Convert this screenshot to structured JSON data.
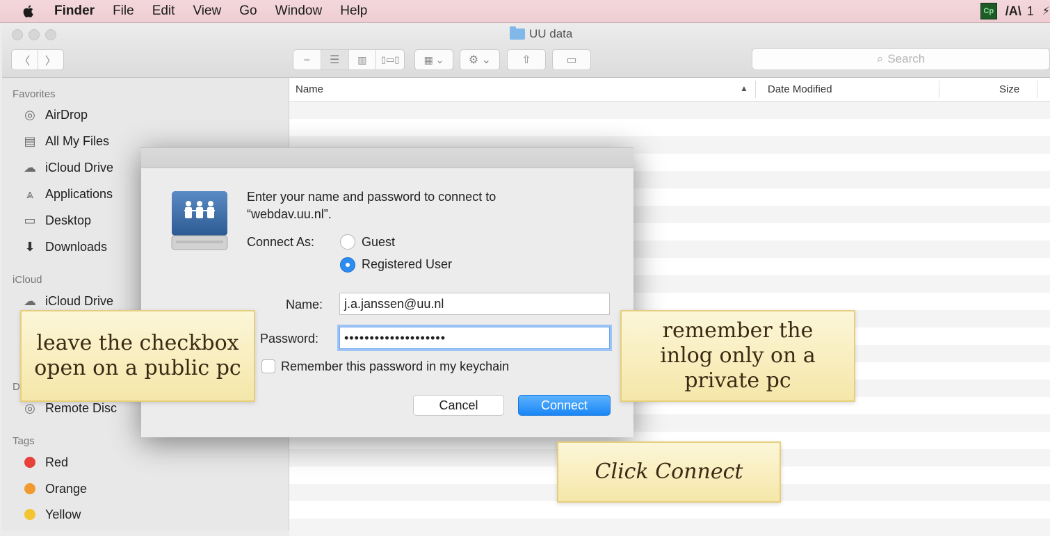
{
  "menubar": {
    "app": "Finder",
    "items": [
      "File",
      "Edit",
      "View",
      "Go",
      "Window",
      "Help"
    ],
    "right_cp": "Cp",
    "right_adobe": "/A\\",
    "right_count": "1"
  },
  "window": {
    "title": "UU data",
    "search_placeholder": "Search"
  },
  "sidebar": {
    "favorites_header": "Favorites",
    "favorites": [
      {
        "label": "AirDrop",
        "icon": "airdrop-icon"
      },
      {
        "label": "All My Files",
        "icon": "all-files-icon"
      },
      {
        "label": "iCloud Drive",
        "icon": "cloud-icon"
      },
      {
        "label": "Applications",
        "icon": "applications-icon"
      },
      {
        "label": "Desktop",
        "icon": "desktop-icon"
      },
      {
        "label": "Downloads",
        "icon": "downloads-icon"
      }
    ],
    "icloud_header": "iCloud",
    "icloud": [
      {
        "label": "iCloud Drive",
        "icon": "cloud-icon"
      }
    ],
    "devices_header_partial": "D",
    "devices": [
      {
        "label": "Remote Disc",
        "icon": "remote-disc-icon"
      }
    ],
    "tags_header": "Tags",
    "tags": [
      {
        "label": "Red",
        "color": "#e8403a"
      },
      {
        "label": "Orange",
        "color": "#f29a32"
      },
      {
        "label": "Yellow",
        "color": "#f4c531"
      }
    ]
  },
  "list": {
    "columns": [
      "Name",
      "Date Modified",
      "Size"
    ]
  },
  "dialog": {
    "prompt_line1": "Enter your name and password to connect to",
    "prompt_line2": "“webdav.uu.nl”.",
    "connect_as_label": "Connect As:",
    "option_guest": "Guest",
    "option_registered": "Registered User",
    "selected_option": "Registered User",
    "name_label": "Name:",
    "name_value": "j.a.janssen@uu.nl",
    "password_label": "Password:",
    "password_value": "••••••••••••••••••••",
    "remember_label": "Remember this password in my keychain",
    "remember_checked": false,
    "cancel_label": "Cancel",
    "connect_label": "Connect"
  },
  "captions": {
    "left": "leave the checkbox open on a public pc",
    "right": "remember the inlog only on a private pc",
    "bottom": "Click Connect"
  }
}
